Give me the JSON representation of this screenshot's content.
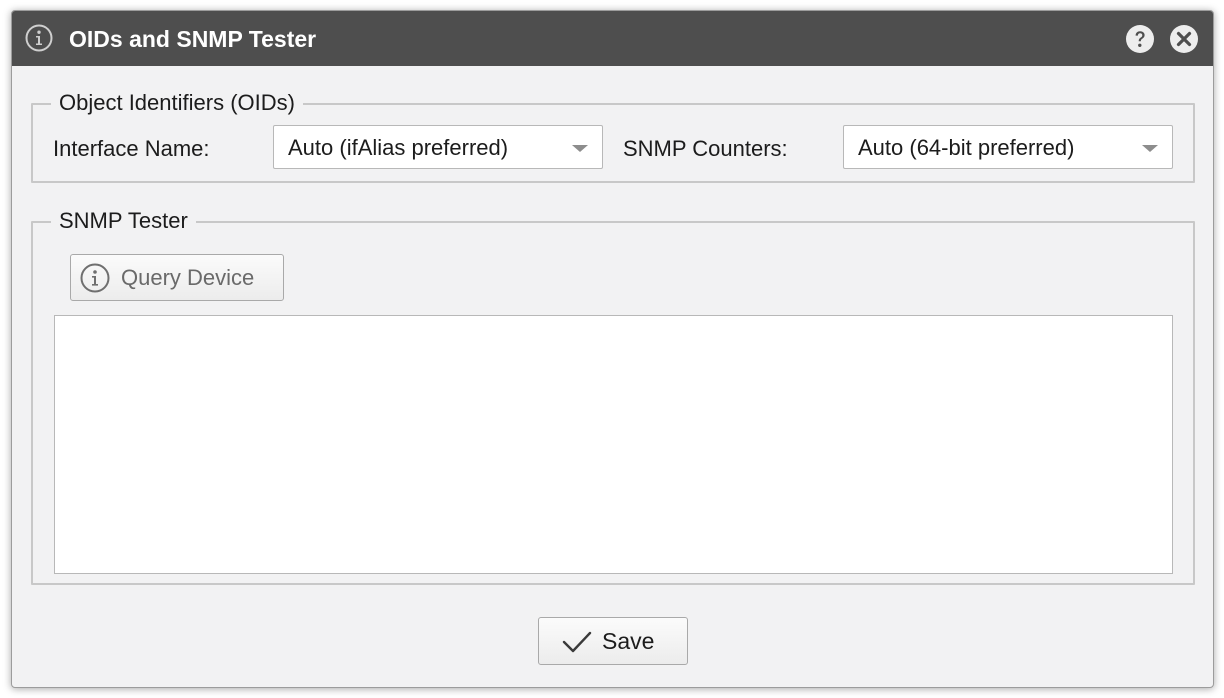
{
  "dialog": {
    "title": "OIDs and SNMP Tester",
    "title_icon": "info-icon",
    "help_icon": "help-icon",
    "close_icon": "close-icon"
  },
  "oids": {
    "legend": "Object Identifiers (OIDs)",
    "interface_name_label": "Interface Name:",
    "interface_name_value": "Auto (ifAlias preferred)",
    "snmp_counters_label": "SNMP Counters:",
    "snmp_counters_value": "Auto (64-bit preferred)"
  },
  "tester": {
    "legend": "SNMP Tester",
    "query_button_label": "Query Device",
    "query_button_icon": "info-icon",
    "output_text": ""
  },
  "footer": {
    "save_label": "Save",
    "save_icon": "checkmark-icon"
  },
  "colors": {
    "titlebar": "#4e4e4e",
    "dialog_bg": "#f2f2f3",
    "border": "#c8c8c8"
  }
}
